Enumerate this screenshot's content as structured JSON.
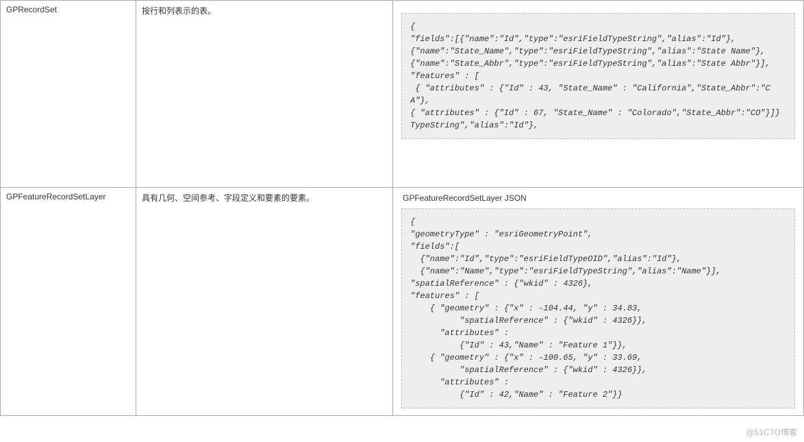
{
  "rows": [
    {
      "name": "GPRecordSet",
      "desc": "按行和列表示的表。",
      "exampleTitle": "",
      "code": "{\n\"fields\":[{\"name\":\"Id\",\"type\":\"esriFieldTypeString\",\"alias\":\"Id\"},\n{\"name\":\"State_Name\",\"type\":\"esriFieldTypeString\",\"alias\":\"State Name\"},\n{\"name\":\"State_Abbr\",\"type\":\"esriFieldTypeString\",\"alias\":\"State Abbr\"}],\n\"features\" : [\n { \"attributes\" : {\"Id\" : 43, \"State_Name\" : \"California\",\"State_Abbr\":\"CA\"},\n{ \"attributes\" : {\"Id\" : 67, \"State_Name\" : \"Colorado\",\"State_Abbr\":\"CO\"}]}\nTypeString\",\"alias\":\"Id\"},"
    },
    {
      "name": "GPFeatureRecordSetLayer",
      "desc": "具有几何、空间参考、字段定义和要素的要素。",
      "exampleTitle": "GPFeatureRecordSetLayer JSON",
      "code": "{\n\"geometryType\" : \"esriGeometryPoint\",\n\"fields\":[\n  {\"name\":\"Id\",\"type\":\"esriFieldTypeOID\",\"alias\":\"Id\"},\n  {\"name\":\"Name\",\"type\":\"esriFieldTypeString\",\"alias\":\"Name\"}],\n\"spatialReference\" : {\"wkid\" : 4326},\n\"features\" : [\n    { \"geometry\" : {\"x\" : -104.44, \"y\" : 34.83,\n          \"spatialReference\" : {\"wkid\" : 4326}},\n      \"attributes\" : \n          {\"Id\" : 43,\"Name\" : \"Feature 1\"}},\n    { \"geometry\" : {\"x\" : -100.65, \"y\" : 33.69,\n          \"spatialReference\" : {\"wkid\" : 4326}},\n      \"attributes\" : \n          {\"Id\" : 42,\"Name\" : \"Feature 2\"}}"
    }
  ],
  "watermark": "@51CTO博客"
}
